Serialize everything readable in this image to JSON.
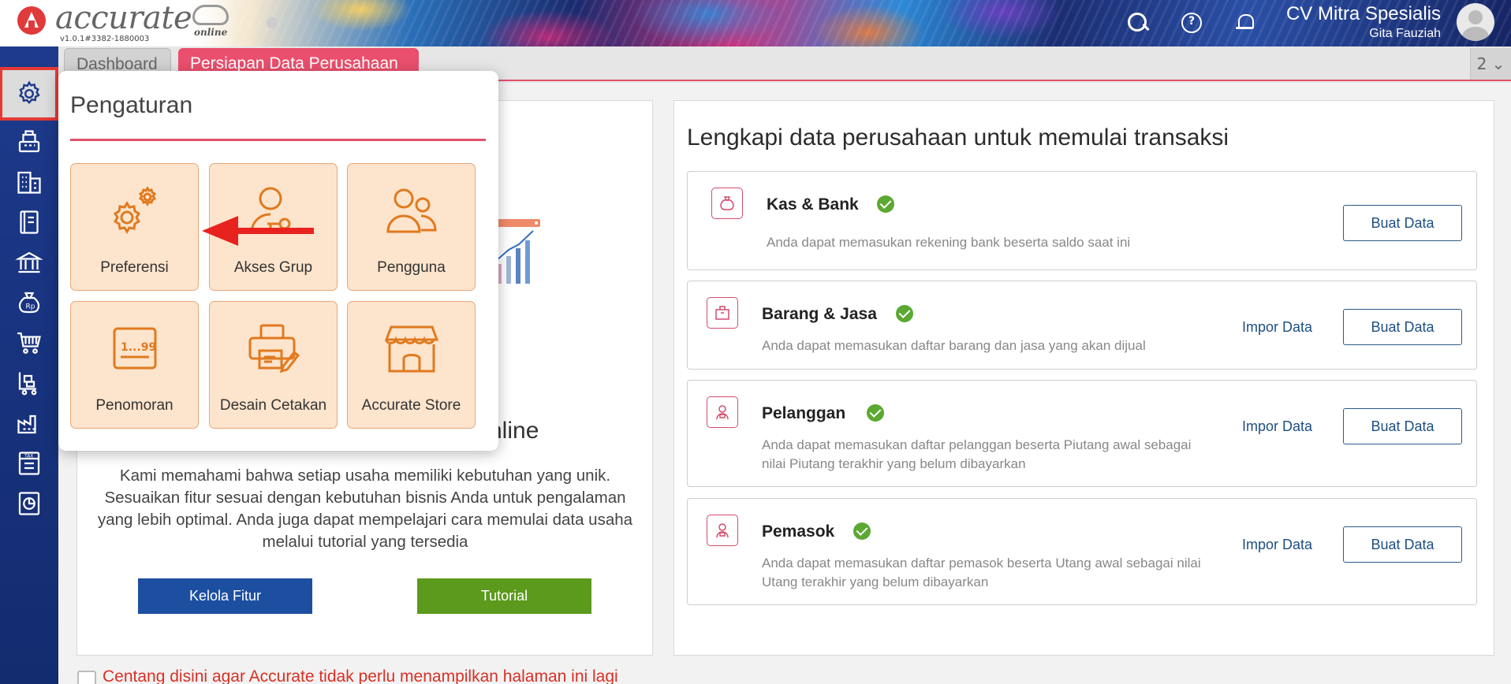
{
  "header": {
    "logo_text": "accurate",
    "logo_sub": "online",
    "version": "v1.0.1#3382-1880003",
    "company_name": "CV Mitra Spesialis",
    "user_name": "Gita Fauziah",
    "icons": [
      "search-icon",
      "help-icon",
      "bell-icon",
      "avatar"
    ]
  },
  "sidebar": {
    "items": [
      {
        "name": "gear-icon",
        "active": true
      },
      {
        "name": "cash-register-icon"
      },
      {
        "name": "building-icon"
      },
      {
        "name": "ledger-icon"
      },
      {
        "name": "bank-icon"
      },
      {
        "name": "money-bag-icon"
      },
      {
        "name": "cart-icon"
      },
      {
        "name": "delivery-cart-icon"
      },
      {
        "name": "factory-icon"
      },
      {
        "name": "tax-icon"
      },
      {
        "name": "report-icon"
      }
    ]
  },
  "tabs": {
    "dashboard": "Dashboard",
    "persiapan": "Persiapan Data Perusahaan",
    "count": "2 ⌄"
  },
  "popup": {
    "title": "Pengaturan",
    "tiles": [
      {
        "label": "Preferensi",
        "icon": "gears-icon"
      },
      {
        "label": "Akses Grup",
        "icon": "user-key-icon"
      },
      {
        "label": "Pengguna",
        "icon": "users-icon"
      },
      {
        "label": "Penomoran",
        "icon": "numbering-icon"
      },
      {
        "label": "Desain Cetakan",
        "icon": "printer-design-icon"
      },
      {
        "label": "Accurate Store",
        "icon": "store-icon"
      }
    ]
  },
  "left_panel": {
    "heading_fragment": "nline",
    "description": "Kami memahami bahwa setiap usaha memiliki kebutuhan yang unik. Sesuaikan fitur sesuai dengan kebutuhan bisnis Anda untuk pengalaman yang lebih optimal. Anda juga dapat mempelajari cara memulai data usaha melalui tutorial yang tersedia",
    "btn_kelola": "Kelola Fitur",
    "btn_tutorial": "Tutorial",
    "footer": "Centang disini agar Accurate tidak perlu menampilkan halaman ini lagi"
  },
  "right_panel": {
    "title": "Lengkapi data perusahaan untuk memulai transaksi",
    "cards": [
      {
        "title": "Kas & Bank",
        "desc": "Anda dapat memasukan rekening bank beserta saldo saat ini",
        "buat": "Buat Data",
        "impor": ""
      },
      {
        "title": "Barang & Jasa",
        "desc": "Anda dapat memasukan daftar barang dan jasa yang akan dijual",
        "buat": "Buat Data",
        "impor": "Impor Data"
      },
      {
        "title": "Pelanggan",
        "desc": "Anda dapat memasukan daftar pelanggan beserta Piutang awal sebagai nilai Piutang terakhir yang belum dibayarkan",
        "buat": "Buat Data",
        "impor": "Impor Data"
      },
      {
        "title": "Pemasok",
        "desc": "Anda dapat memasukan daftar pemasok beserta Utang awal sebagai nilai Utang terakhir yang belum dibayarkan",
        "buat": "Buat Data",
        "impor": "Impor Data"
      }
    ]
  },
  "colors": {
    "accent": "#e25169",
    "sidebar": "#1d3a8c",
    "check_green": "#5ba832",
    "tile_bg": "#fde4cc",
    "icon_orange": "#e07a1f"
  }
}
